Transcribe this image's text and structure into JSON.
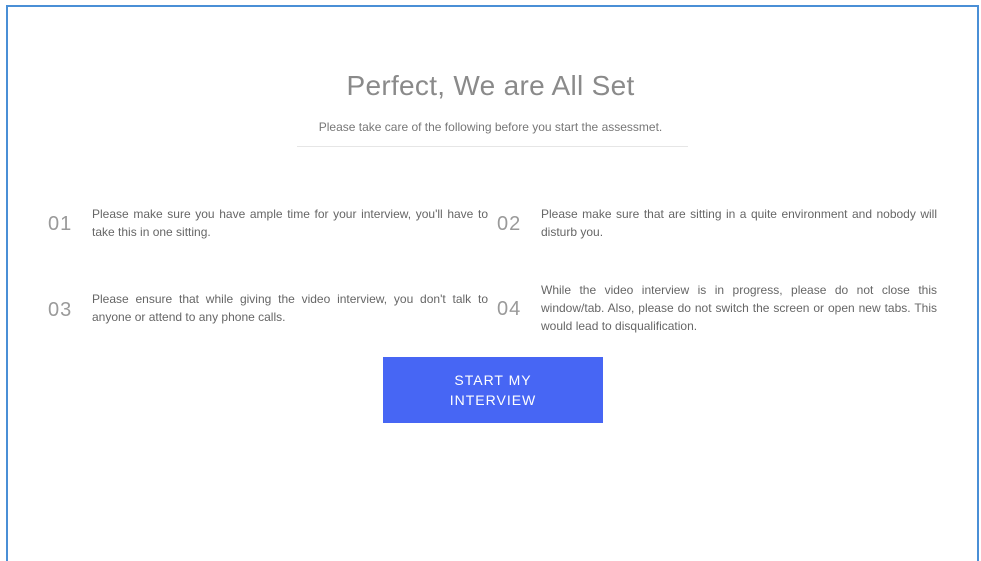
{
  "header": {
    "title": "Perfect, We are All Set",
    "subtitle": "Please take care of the following before you start the assessmet."
  },
  "instructions": [
    {
      "number": "01",
      "text": "Please make sure you have ample time for your interview, you'll have to take this in one sitting."
    },
    {
      "number": "02",
      "text": "Please make sure that are sitting in a quite environment and nobody will disturb you."
    },
    {
      "number": "03",
      "text": "Please ensure that while giving the video interview, you don't talk to anyone or attend to any phone calls."
    },
    {
      "number": "04",
      "text": "While the video interview is in progress, please do not close this window/tab. Also, please do not switch the screen or open new tabs. This would lead to disqualification."
    }
  ],
  "actions": {
    "start_label": "START MY INTERVIEW"
  },
  "colors": {
    "accent": "#4766f4",
    "frame_border": "#4a8fd6"
  }
}
